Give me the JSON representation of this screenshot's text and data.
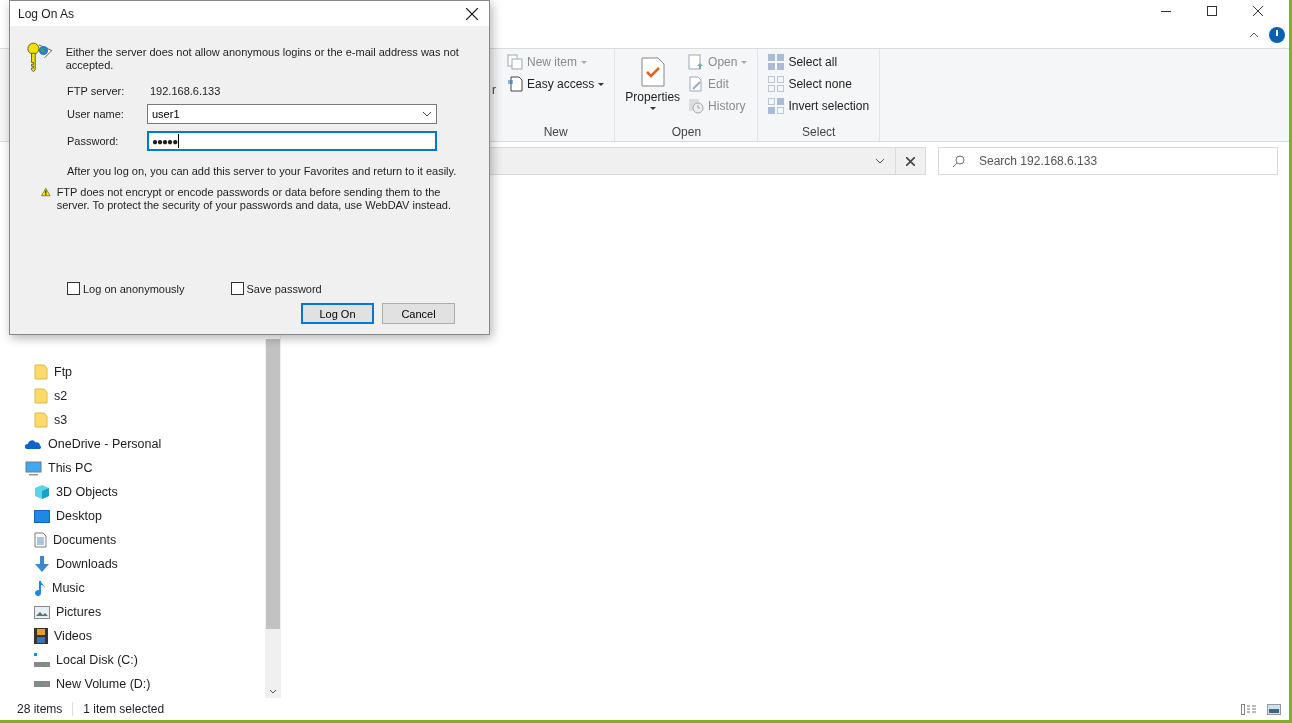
{
  "explorer": {
    "ribbon_partial_label": "r",
    "ribbon_groups": [
      {
        "name": "New",
        "items": [
          {
            "label": "New item",
            "kind": "newitem",
            "dropdown": true,
            "disabled": true
          },
          {
            "label": "Easy access",
            "kind": "easyaccess",
            "dropdown": true,
            "disabled": false
          }
        ]
      },
      {
        "name": "Open",
        "large": {
          "label": "Properties",
          "kind": "properties"
        },
        "items": [
          {
            "label": "Open",
            "kind": "open",
            "dropdown": true,
            "disabled": true
          },
          {
            "label": "Edit",
            "kind": "edit",
            "dropdown": false,
            "disabled": true
          },
          {
            "label": "History",
            "kind": "history",
            "dropdown": false,
            "disabled": true
          }
        ]
      },
      {
        "name": "Select",
        "items": [
          {
            "label": "Select all",
            "kind": "selectall",
            "dropdown": false,
            "disabled": false
          },
          {
            "label": "Select none",
            "kind": "selectnone",
            "dropdown": false,
            "disabled": false
          },
          {
            "label": "Invert selection",
            "kind": "invert",
            "dropdown": false,
            "disabled": false
          }
        ]
      }
    ],
    "search": {
      "placeholder": "Search 192.168.6.133"
    },
    "nav_tree": [
      {
        "label": "Ftp",
        "kind": "folder"
      },
      {
        "label": "s2",
        "kind": "folder"
      },
      {
        "label": "s3",
        "kind": "folder"
      },
      {
        "label": "OneDrive - Personal",
        "kind": "cloud"
      },
      {
        "label": "This PC",
        "kind": "pc",
        "children": [
          {
            "label": "3D Objects",
            "kind": "cube"
          },
          {
            "label": "Desktop",
            "kind": "desktop"
          },
          {
            "label": "Documents",
            "kind": "documents"
          },
          {
            "label": "Downloads",
            "kind": "downloads"
          },
          {
            "label": "Music",
            "kind": "music"
          },
          {
            "label": "Pictures",
            "kind": "pictures"
          },
          {
            "label": "Videos",
            "kind": "videos"
          },
          {
            "label": "Local Disk (C:)",
            "kind": "systemdisk"
          },
          {
            "label": "New Volume (D:)",
            "kind": "disk"
          }
        ]
      }
    ],
    "status_bar": {
      "item_count": "28 items",
      "selection": "1 item selected"
    }
  },
  "dialog": {
    "title": "Log On As",
    "message": "Either the server does not allow anonymous logins or the e-mail address was not accepted.",
    "fields": [
      {
        "label": "FTP server:",
        "kind": "static",
        "value": "192.168.6.133"
      },
      {
        "label": "User name:",
        "kind": "combo",
        "value": "user1"
      },
      {
        "label": "Password:",
        "kind": "password",
        "value": "●●●●●",
        "focused": true
      }
    ],
    "info": "After you log on, you can add this server to your Favorites and return to it easily.",
    "warning": "FTP does not encrypt or encode passwords or data before sending them to the server.  To protect the security of your passwords and data, use WebDAV instead.",
    "checkboxes": [
      {
        "label": "Log on anonymously",
        "checked": false
      },
      {
        "label": "Save password",
        "checked": false
      }
    ],
    "buttons": [
      {
        "label": "Log On",
        "default": true
      },
      {
        "label": "Cancel",
        "default": false
      }
    ]
  }
}
